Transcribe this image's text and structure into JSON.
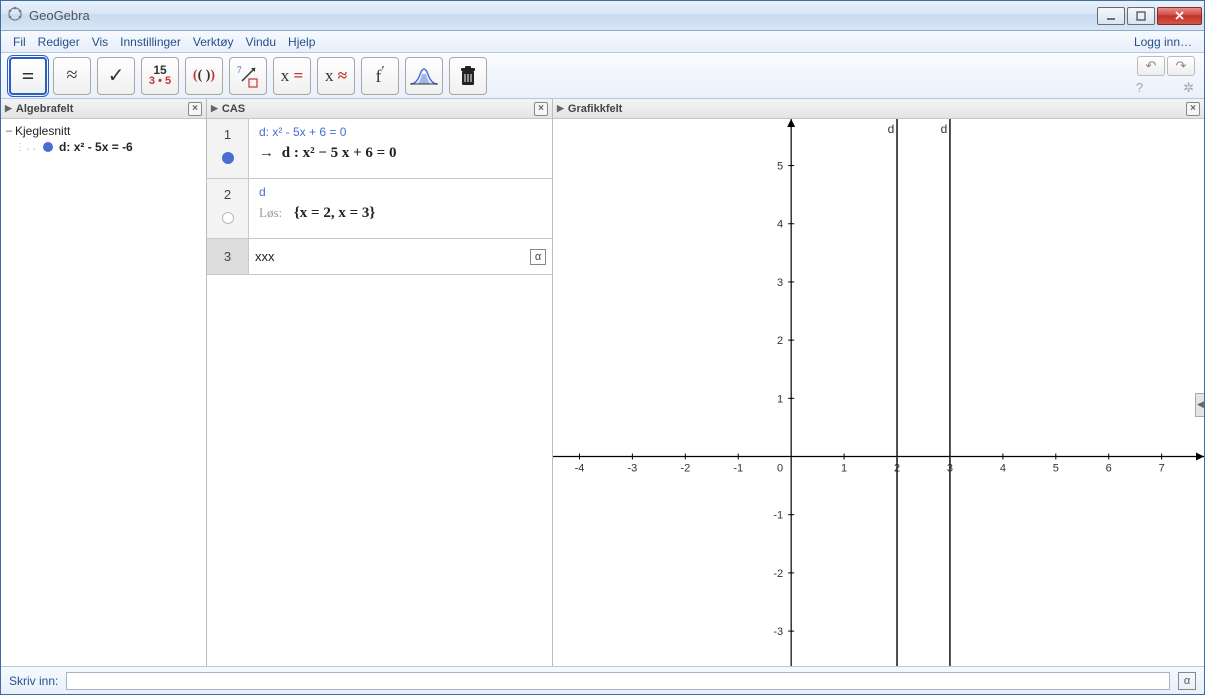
{
  "window": {
    "title": "GeoGebra"
  },
  "menu": {
    "items": [
      "Fil",
      "Rediger",
      "Vis",
      "Innstillinger",
      "Verktøy",
      "Vindu",
      "Hjelp"
    ],
    "right": "Logg inn…"
  },
  "toolbar": {
    "tools": [
      {
        "name": "evaluate-exact",
        "glyph": "=",
        "active": true
      },
      {
        "name": "evaluate-numeric",
        "glyph": "≈"
      },
      {
        "name": "keep-input",
        "glyph": "✓"
      },
      {
        "name": "factor",
        "top": "15",
        "bottom": "3 • 5"
      },
      {
        "name": "parentheses",
        "glyph": "(( ))"
      },
      {
        "name": "substitute",
        "glyph": "↗"
      },
      {
        "name": "solve-exact",
        "left": "x",
        "right": "="
      },
      {
        "name": "solve-numeric",
        "left": "x",
        "right": "≈"
      },
      {
        "name": "derivative",
        "glyph": "f′"
      },
      {
        "name": "probability",
        "glyph": "bell"
      },
      {
        "name": "delete",
        "glyph": "trash"
      }
    ]
  },
  "panels": {
    "algebra": {
      "title": "Algebrafelt",
      "category": "Kjeglesnitt",
      "item": "d: x² - 5x = -6"
    },
    "cas": {
      "title": "CAS",
      "rows": [
        {
          "num": "1",
          "marker": "filled",
          "input": "d: x² - 5x + 6 = 0",
          "output_prefix": "→",
          "output": "d :  x² − 5 x + 6 = 0"
        },
        {
          "num": "2",
          "marker": "hollow",
          "input": "d",
          "label": "Løs:",
          "output": "{x = 2, x = 3}"
        },
        {
          "num": "3",
          "live_input": "xxx"
        }
      ]
    },
    "graphics": {
      "title": "Grafikkfelt",
      "lines": [
        {
          "x": 2,
          "label": "d"
        },
        {
          "x": 3,
          "label": "d"
        }
      ]
    }
  },
  "footer": {
    "label": "Skriv inn:",
    "value": ""
  },
  "chart_data": {
    "type": "line",
    "title": "",
    "xlabel": "",
    "ylabel": "",
    "xlim": [
      -4.5,
      7.8
    ],
    "ylim": [
      -3.6,
      5.8
    ],
    "x_ticks": [
      -4,
      -3,
      -2,
      -1,
      0,
      1,
      2,
      3,
      4,
      5,
      6,
      7
    ],
    "y_ticks": [
      -3,
      -2,
      -1,
      0,
      1,
      2,
      3,
      4,
      5
    ],
    "series": [
      {
        "name": "d",
        "type": "vertical_line",
        "x": 2
      },
      {
        "name": "d",
        "type": "vertical_line",
        "x": 3
      }
    ]
  }
}
